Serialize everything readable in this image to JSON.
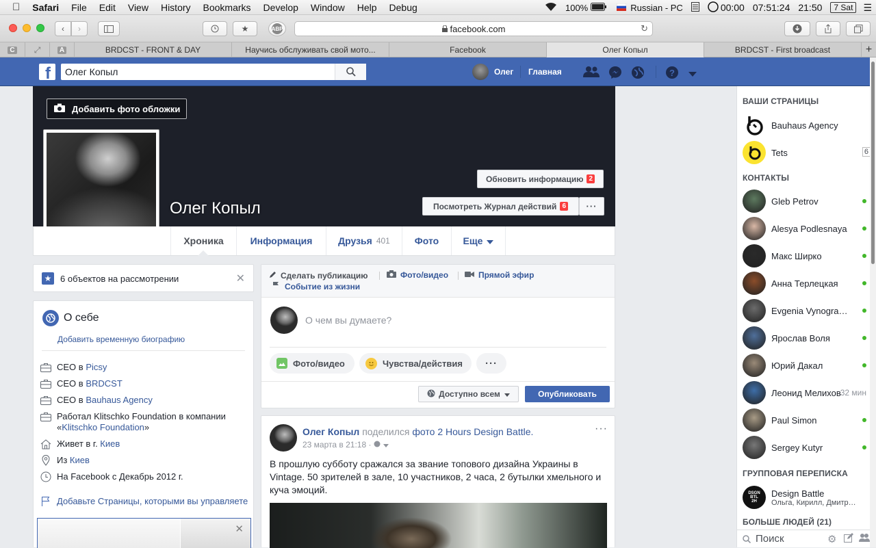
{
  "macos_menubar": {
    "app": "Safari",
    "menus": [
      "File",
      "Edit",
      "View",
      "History",
      "Bookmarks",
      "Develop",
      "Window",
      "Help",
      "Debug"
    ],
    "battery": "100%",
    "input_source": "Russian - PC",
    "timer": "00:00",
    "clock1": "07:51:24",
    "clock2": "21:50",
    "date": "7 Sat"
  },
  "browser": {
    "url": "facebook.com",
    "tabs": [
      {
        "label": "BRDCST - FRONT & DAY"
      },
      {
        "label": "Научись обслуживать свой мото..."
      },
      {
        "label": "Facebook"
      },
      {
        "label": "Олег Копыл"
      },
      {
        "label": "BRDCST - First broadcast"
      }
    ],
    "pinned_tabs": [
      "C",
      "A"
    ],
    "extension_label": "ABP"
  },
  "fb_nav": {
    "search_value": "Олег Копыл",
    "user_name": "Олег",
    "home_label": "Главная",
    "colors": {
      "brand": "#4267b2",
      "badge": "#fa3e3e"
    }
  },
  "cover": {
    "add_cover_label": "Добавить фото обложки",
    "profile_name": "Олег Копыл",
    "update_info_label": "Обновить информацию",
    "update_info_badge": "2",
    "activity_log_label": "Посмотреть Журнал действий",
    "activity_log_badge": "6",
    "more_label": "···"
  },
  "profile_tabs": [
    {
      "label": "Хроника",
      "count": ""
    },
    {
      "label": "Информация",
      "count": ""
    },
    {
      "label": "Друзья",
      "count": "401"
    },
    {
      "label": "Фото",
      "count": ""
    },
    {
      "label": "Еще",
      "count": ""
    }
  ],
  "review": {
    "text": "6 объектов на рассмотрении"
  },
  "about": {
    "title": "О себе",
    "add_bio": "Добавить временную биографию",
    "rows": [
      {
        "icon": "briefcase-icon",
        "prefix": "CEO в ",
        "link": "Picsy",
        "suffix": ""
      },
      {
        "icon": "briefcase-icon",
        "prefix": "CEO в ",
        "link": "BRDCST",
        "suffix": ""
      },
      {
        "icon": "briefcase-icon",
        "prefix": "CEO в ",
        "link": "Bauhaus Agency",
        "suffix": ""
      },
      {
        "icon": "briefcase-icon",
        "prefix": "Работал Klitschko Foundation в компании «",
        "link": "Klitschko Foundation",
        "suffix": "»"
      },
      {
        "icon": "home-icon",
        "prefix": "Живет в г. ",
        "link": "Киев",
        "suffix": ""
      },
      {
        "icon": "pin-icon",
        "prefix": "Из ",
        "link": "Киев",
        "suffix": ""
      },
      {
        "icon": "clock-icon",
        "prefix": "На Facebook с Декабрь 2012 г.",
        "link": "",
        "suffix": ""
      }
    ],
    "add_pages": "Добавьте Страницы, которыми вы управляете"
  },
  "composer": {
    "tab_post": "Сделать публикацию",
    "tab_photo": "Фото/видео",
    "tab_live": "Прямой эфир",
    "tab_event": "Событие из жизни",
    "placeholder": "О чем вы думаете?",
    "btn_photo": "Фото/видео",
    "btn_feeling": "Чувства/действия",
    "audience": "Доступно всем",
    "publish": "Опубликовать"
  },
  "post": {
    "author": "Олег Копыл",
    "action": " поделился ",
    "object": "фото 2 Hours Design Battle.",
    "date": "23 марта в 21:18 ·",
    "text": "В прошлую субботу сражался за звание топового дизайна Украины в Vintage. 50 зрителей в зале, 10 участников, 2 часа, 2 бутылки хмельного и куча эмоций."
  },
  "sidebar": {
    "pages_title": "ВАШИ СТРАНИЦЫ",
    "pages": [
      {
        "name": "Bauhaus Agency",
        "count": ""
      },
      {
        "name": "Tets",
        "count": "6"
      }
    ],
    "contacts_title": "КОНТАКТЫ",
    "contacts": [
      {
        "name": "Gleb Petrov",
        "status": "online",
        "time": ""
      },
      {
        "name": "Alesya Podlesnaya",
        "status": "online",
        "time": ""
      },
      {
        "name": "Макс Ширко",
        "status": "online",
        "time": ""
      },
      {
        "name": "Анна Терлецкая",
        "status": "online",
        "time": ""
      },
      {
        "name": "Evgenia Vynogradova",
        "status": "online",
        "time": ""
      },
      {
        "name": "Ярослав Воля",
        "status": "online",
        "time": ""
      },
      {
        "name": "Юрий Дакал",
        "status": "online",
        "time": ""
      },
      {
        "name": "Леонид Мелихов",
        "status": "idle",
        "time": "32 мин"
      },
      {
        "name": "Paul Simon",
        "status": "online",
        "time": ""
      },
      {
        "name": "Sergey Kutyr",
        "status": "online",
        "time": ""
      }
    ],
    "group_title": "ГРУППОВАЯ ПЕРЕПИСКА",
    "group": {
      "name": "Design Battle",
      "members": "Ольга, Кирилл, Дмитрий..."
    },
    "more_people": "БОЛЬШЕ ЛЮДЕЙ (21)",
    "search_placeholder": "Поиск"
  }
}
